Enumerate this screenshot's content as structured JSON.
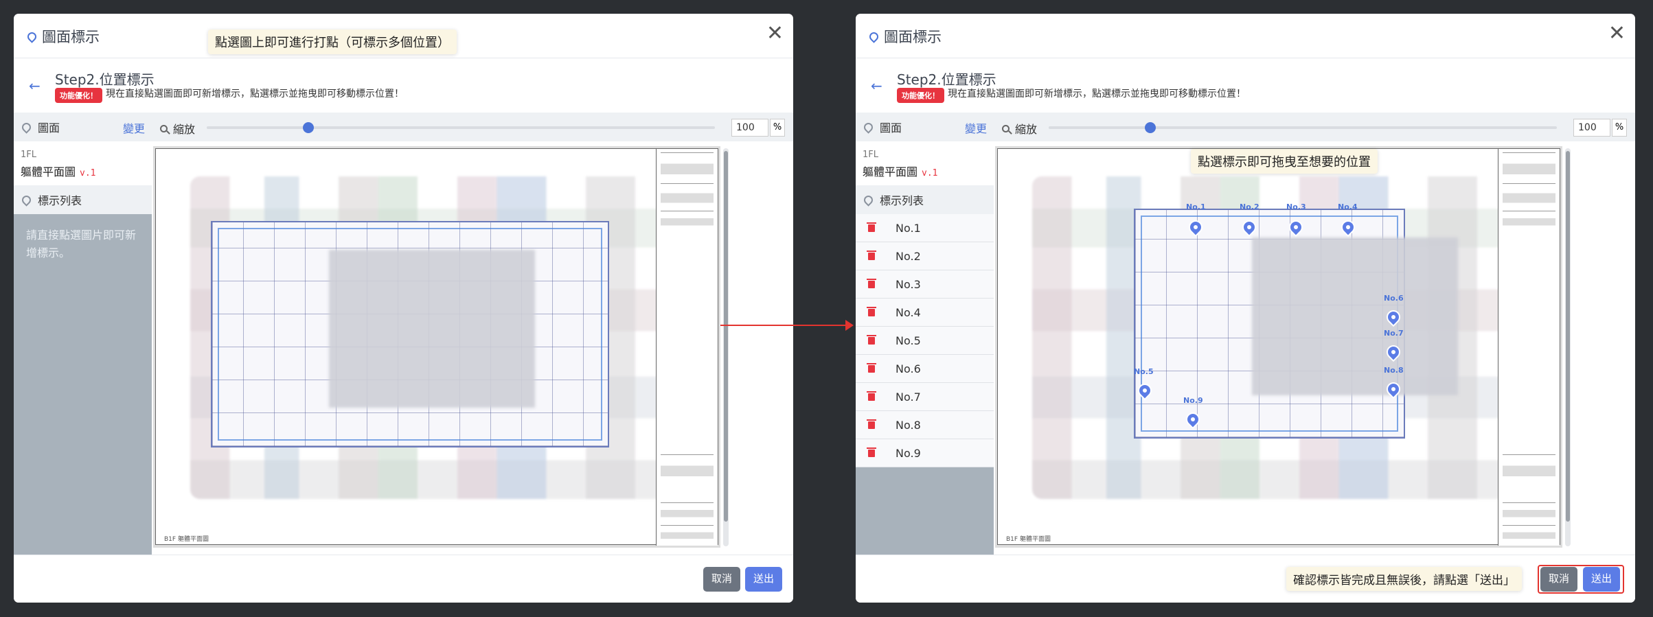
{
  "left": {
    "title": "圖面標示",
    "hint": "點選圖上即可進行打點（可標示多個位置）",
    "step_title": "Step2.位置標示",
    "badge": "功能優化！",
    "notice": "現在直接點選圖面即可新增標示，點選標示並拖曳即可移動標示位置！",
    "plan_header": "圖面",
    "change": "變更",
    "floor_level": "1FL",
    "floor_name": "軀體平面圖",
    "floor_version": "v.1",
    "marker_list_header": "標示列表",
    "empty_text": "請直接點選圖片即可新增標示。",
    "zoom_label": "縮放",
    "zoom_value": "100",
    "zoom_unit": "%",
    "sheet_label": "B1F 軀體平面圖",
    "cancel": "取消",
    "send": "送出"
  },
  "right": {
    "title": "圖面標示",
    "hint": "點選標示即可拖曳至想要的位置",
    "step_title": "Step2.位置標示",
    "badge": "功能優化！",
    "notice": "現在直接點選圖面即可新增標示，點選標示並拖曳即可移動標示位置！",
    "plan_header": "圖面",
    "change": "變更",
    "floor_level": "1FL",
    "floor_name": "軀體平面圖",
    "floor_version": "v.1",
    "marker_list_header": "標示列表",
    "markers": [
      "No.1",
      "No.2",
      "No.3",
      "No.4",
      "No.5",
      "No.6",
      "No.7",
      "No.8",
      "No.9"
    ],
    "zoom_label": "縮放",
    "zoom_value": "100",
    "zoom_unit": "%",
    "sheet_label": "B1F 軀體平面圖",
    "footer_hint": "確認標示皆完成且無誤後，請點選「送出」",
    "cancel": "取消",
    "send": "送出"
  },
  "zoom_level": 0.2,
  "colors": {
    "accent": "#5b7ce6",
    "danger": "#e7343f",
    "arrow": "#e3342f"
  }
}
